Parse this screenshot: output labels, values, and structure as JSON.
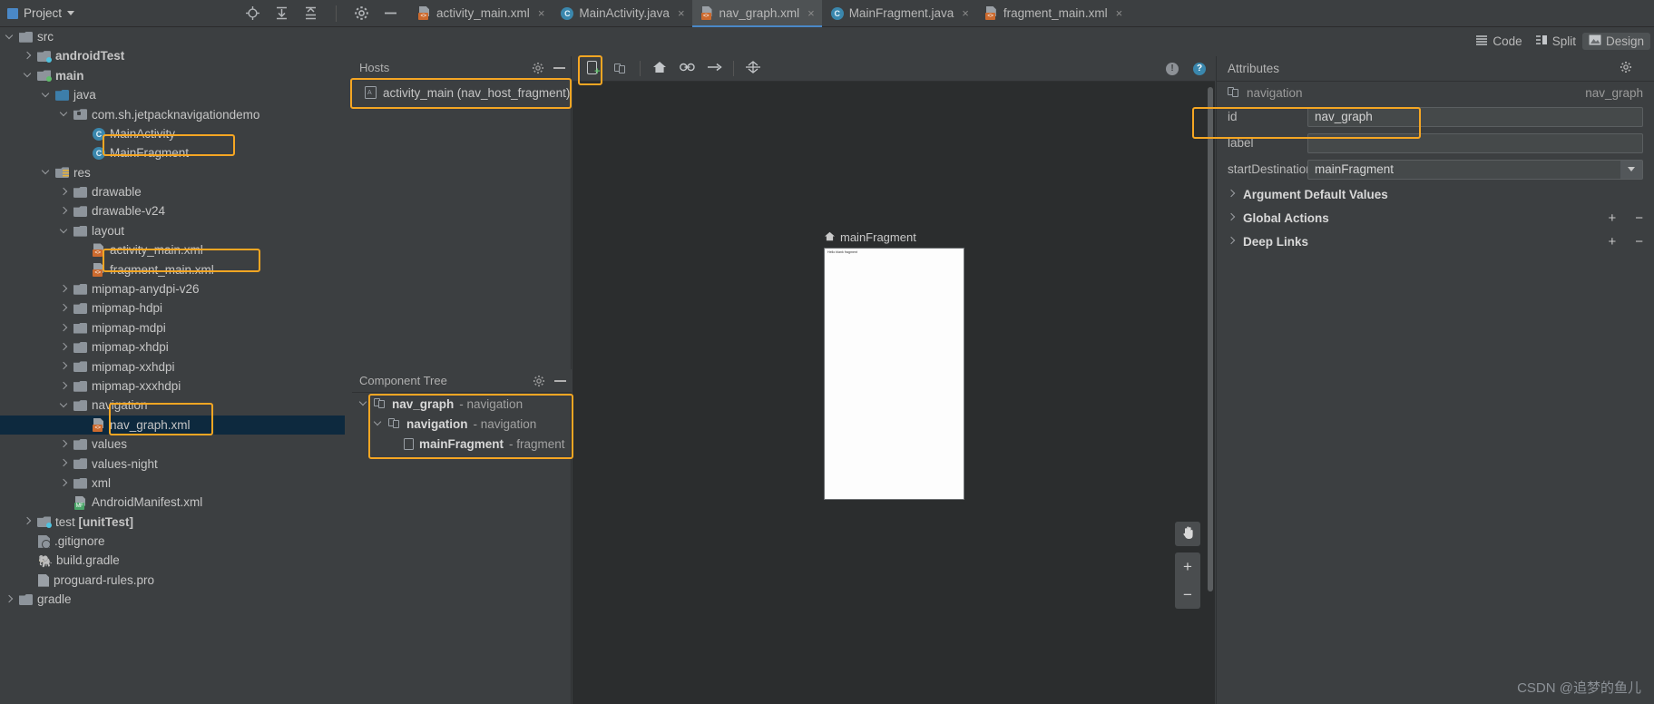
{
  "topbar": {
    "project_label": "Project",
    "icons": [
      "target-icon",
      "collapse-all-icon",
      "expand-all-icon",
      "settings-gear-icon",
      "minimize-icon"
    ],
    "tabs": [
      {
        "label": "activity_main.xml",
        "icon": "xml-layout-file-icon",
        "active": false,
        "close": "×"
      },
      {
        "label": "MainActivity.java",
        "icon": "java-class-icon",
        "active": false,
        "close": "×"
      },
      {
        "label": "nav_graph.xml",
        "icon": "xml-layout-file-icon",
        "active": true,
        "close": "×"
      },
      {
        "label": "MainFragment.java",
        "icon": "java-class-icon",
        "active": false,
        "close": "×"
      },
      {
        "label": "fragment_main.xml",
        "icon": "xml-layout-file-icon",
        "active": false,
        "close": "×"
      }
    ]
  },
  "mode_switch": {
    "options": [
      {
        "label": "Code",
        "icon": "code-lines-icon",
        "active": false
      },
      {
        "label": "Split",
        "icon": "split-view-icon",
        "active": false
      },
      {
        "label": "Design",
        "icon": "design-view-icon",
        "active": true
      }
    ]
  },
  "project_tree": [
    {
      "indent": 1,
      "label": "src",
      "icon": "folder-icon",
      "arrow": "down",
      "bold": false
    },
    {
      "indent": 2,
      "label": "androidTest",
      "icon": "folder-test-icon",
      "arrow": "right",
      "bold": true
    },
    {
      "indent": 2,
      "label": "main",
      "icon": "folder-source-icon",
      "arrow": "down",
      "bold": true
    },
    {
      "indent": 3,
      "label": "java",
      "icon": "folder-java-icon",
      "arrow": "down",
      "bold": false
    },
    {
      "indent": 4,
      "label": "com.sh.jetpacknavigationdemo",
      "icon": "package-icon",
      "arrow": "down",
      "bold": false
    },
    {
      "indent": 5,
      "label": "MainActivity",
      "icon": "java-class-icon",
      "arrow": "none",
      "bold": false
    },
    {
      "indent": 5,
      "label": "MainFragment",
      "icon": "java-class-icon",
      "arrow": "none",
      "bold": false,
      "highlight": true
    },
    {
      "indent": 3,
      "label": "res",
      "icon": "folder-res-icon",
      "arrow": "down",
      "bold": false
    },
    {
      "indent": 4,
      "label": "drawable",
      "icon": "folder-icon",
      "arrow": "right",
      "bold": false
    },
    {
      "indent": 4,
      "label": "drawable-v24",
      "icon": "folder-icon",
      "arrow": "right",
      "bold": false
    },
    {
      "indent": 4,
      "label": "layout",
      "icon": "folder-icon",
      "arrow": "down",
      "bold": false
    },
    {
      "indent": 5,
      "label": "activity_main.xml",
      "icon": "xml-layout-file-icon",
      "arrow": "none",
      "bold": false
    },
    {
      "indent": 5,
      "label": "fragment_main.xml",
      "icon": "xml-layout-file-icon",
      "arrow": "none",
      "bold": false,
      "highlight": true
    },
    {
      "indent": 4,
      "label": "mipmap-anydpi-v26",
      "icon": "folder-icon",
      "arrow": "right",
      "bold": false
    },
    {
      "indent": 4,
      "label": "mipmap-hdpi",
      "icon": "folder-icon",
      "arrow": "right",
      "bold": false
    },
    {
      "indent": 4,
      "label": "mipmap-mdpi",
      "icon": "folder-icon",
      "arrow": "right",
      "bold": false
    },
    {
      "indent": 4,
      "label": "mipmap-xhdpi",
      "icon": "folder-icon",
      "arrow": "right",
      "bold": false
    },
    {
      "indent": 4,
      "label": "mipmap-xxhdpi",
      "icon": "folder-icon",
      "arrow": "right",
      "bold": false
    },
    {
      "indent": 4,
      "label": "mipmap-xxxhdpi",
      "icon": "folder-icon",
      "arrow": "right",
      "bold": false
    },
    {
      "indent": 4,
      "label": "navigation",
      "icon": "folder-icon",
      "arrow": "down",
      "bold": false
    },
    {
      "indent": 5,
      "label": "nav_graph.xml",
      "icon": "xml-layout-file-icon",
      "arrow": "none",
      "bold": false,
      "selected": true,
      "highlight": true
    },
    {
      "indent": 4,
      "label": "values",
      "icon": "folder-icon",
      "arrow": "right",
      "bold": false
    },
    {
      "indent": 4,
      "label": "values-night",
      "icon": "folder-icon",
      "arrow": "right",
      "bold": false
    },
    {
      "indent": 4,
      "label": "xml",
      "icon": "folder-icon",
      "arrow": "right",
      "bold": false
    },
    {
      "indent": 4,
      "label": "AndroidManifest.xml",
      "icon": "manifest-file-icon",
      "arrow": "none",
      "bold": false
    },
    {
      "indent": 2,
      "label": "test [unitTest]",
      "icon": "folder-test-icon",
      "arrow": "right",
      "bold": false,
      "bold_tail": "[unitTest]"
    },
    {
      "indent": 2,
      "label": ".gitignore",
      "icon": "gitignore-file-icon",
      "arrow": "none",
      "bold": false
    },
    {
      "indent": 2,
      "label": "build.gradle",
      "icon": "gradle-file-icon",
      "arrow": "none",
      "bold": false
    },
    {
      "indent": 2,
      "label": "proguard-rules.pro",
      "icon": "text-file-icon",
      "arrow": "none",
      "bold": false
    },
    {
      "indent": 1,
      "label": "gradle",
      "icon": "folder-icon",
      "arrow": "right",
      "bold": false
    }
  ],
  "hosts_panel": {
    "title": "Hosts",
    "gear_icon": "gear-icon",
    "minimize_icon": "minimize-icon",
    "items": [
      {
        "label": "activity_main (nav_host_fragment)",
        "icon": "layout-host-icon"
      }
    ]
  },
  "component_tree": {
    "title": "Component Tree",
    "gear_icon": "gear-icon",
    "minimize_icon": "minimize-icon",
    "rows": [
      {
        "indent": 0,
        "name": "nav_graph",
        "type": " - navigation",
        "arrow": "down",
        "icon": "navigation-graph-icon"
      },
      {
        "indent": 1,
        "name": "navigation",
        "type": " - navigation",
        "arrow": "down",
        "icon": "navigation-graph-icon"
      },
      {
        "indent": 2,
        "name": "mainFragment",
        "type": " - fragment",
        "arrow": "none",
        "icon": "fragment-icon"
      }
    ]
  },
  "design_toolbar": {
    "buttons": [
      {
        "name": "new-destination-button",
        "icon": "new-destination-icon",
        "highlight": true
      },
      {
        "name": "new-nested-graph-button",
        "icon": "nested-graph-icon"
      },
      {
        "name": "start-destination-button",
        "icon": "home-icon"
      },
      {
        "name": "add-action-button",
        "icon": "link-icon"
      },
      {
        "name": "add-deeplink-button",
        "icon": "arrow-right-icon"
      },
      {
        "name": "auto-arrange-button",
        "icon": "auto-arrange-icon"
      }
    ],
    "warning_icon": "!",
    "help_icon": "?"
  },
  "canvas": {
    "destination": {
      "label": "mainFragment",
      "start_icon": "home-icon",
      "preview_text": "Hello blank fragment"
    },
    "pan_icon": "pan-hand-icon",
    "zoom_in": "+",
    "zoom_out": "−"
  },
  "attributes": {
    "title": "Attributes",
    "gear_icon": "gear-icon",
    "minimize_icon": "minimize-icon",
    "component": {
      "type": "navigation",
      "id_value": "nav_graph",
      "icon": "navigation-graph-icon"
    },
    "fields": [
      {
        "key": "id",
        "value": "nav_graph",
        "kind": "text",
        "highlight": true
      },
      {
        "key": "label",
        "value": "",
        "kind": "text"
      },
      {
        "key": "startDestination",
        "value": "mainFragment",
        "kind": "combo"
      }
    ],
    "sections": [
      {
        "label": "Argument Default Values",
        "plus": "",
        "minus": ""
      },
      {
        "label": "Global Actions",
        "plus": "+",
        "minus": "−"
      },
      {
        "label": "Deep Links",
        "plus": "+",
        "minus": "−"
      }
    ]
  },
  "watermark": "CSDN @追梦的鱼儿",
  "colors": {
    "highlight": "#f5a623",
    "selection": "#0d293e",
    "accent": "#4a88c7",
    "panel_bg": "#3c3f41",
    "canvas_bg": "#2b2d2e"
  }
}
